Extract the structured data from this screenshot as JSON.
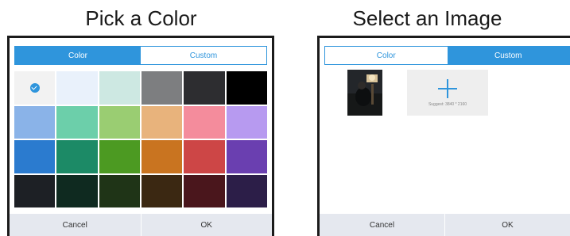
{
  "left_panel": {
    "caption": "Pick a Color",
    "tabs": {
      "color_label": "Color",
      "custom_label": "Custom",
      "active": "Color"
    },
    "swatches": [
      [
        "#f2f2f2",
        "#e9f1fb",
        "#cde8e2",
        "#7d7e80",
        "#2d2d30",
        "#000000"
      ],
      [
        "#8ab3e8",
        "#6ccfaa",
        "#9acd72",
        "#e8b37c",
        "#f48c9c",
        "#b79af0"
      ],
      [
        "#2b7bcf",
        "#1c8a66",
        "#4c9a22",
        "#c97420",
        "#cd4646",
        "#6a3fb0"
      ],
      [
        "#1d2025",
        "#0f2a20",
        "#1f3417",
        "#3b2812",
        "#4a161c",
        "#2c1e48"
      ]
    ],
    "selected_swatch": "0-0",
    "buttons": {
      "cancel": "Cancel",
      "ok": "OK"
    }
  },
  "right_panel": {
    "caption": "Select an Image",
    "tabs": {
      "color_label": "Color",
      "custom_label": "Custom",
      "active": "Custom"
    },
    "add_tile": {
      "icon": "plus-icon",
      "suggest_text": "Suggest: 3840 * 2160"
    },
    "buttons": {
      "cancel": "Cancel",
      "ok": "OK"
    }
  },
  "colors": {
    "accent": "#2f95dc",
    "footer_bg": "#e5e8ef",
    "dialog_border": "#1b1b1b"
  }
}
